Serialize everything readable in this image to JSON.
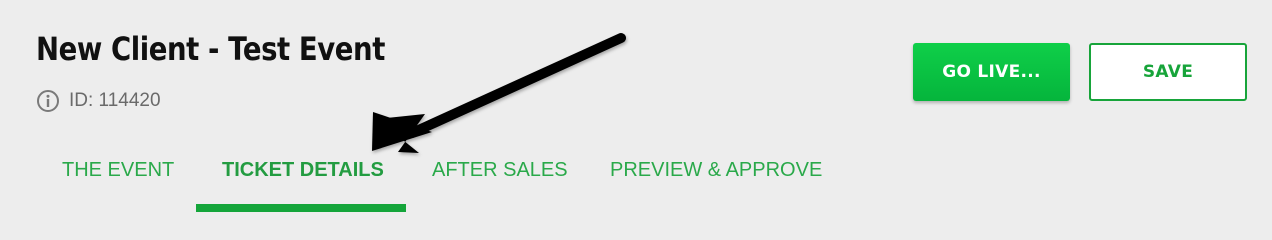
{
  "header": {
    "title": "New Client - Test Event",
    "id_label": "ID: 114420",
    "info_icon": "info-circle-icon"
  },
  "actions": {
    "go_live_label": "GO LIVE...",
    "save_label": "SAVE"
  },
  "tabs": [
    {
      "label": "THE EVENT",
      "active": false
    },
    {
      "label": "TICKET DETAILS",
      "active": true
    },
    {
      "label": "AFTER SALES",
      "active": false
    },
    {
      "label": "PREVIEW & APPROVE",
      "active": false
    }
  ],
  "colors": {
    "accent": "#14a53a",
    "tab_text": "#2aa94a",
    "background": "#ededed",
    "annotation_arrow": "#000000"
  }
}
